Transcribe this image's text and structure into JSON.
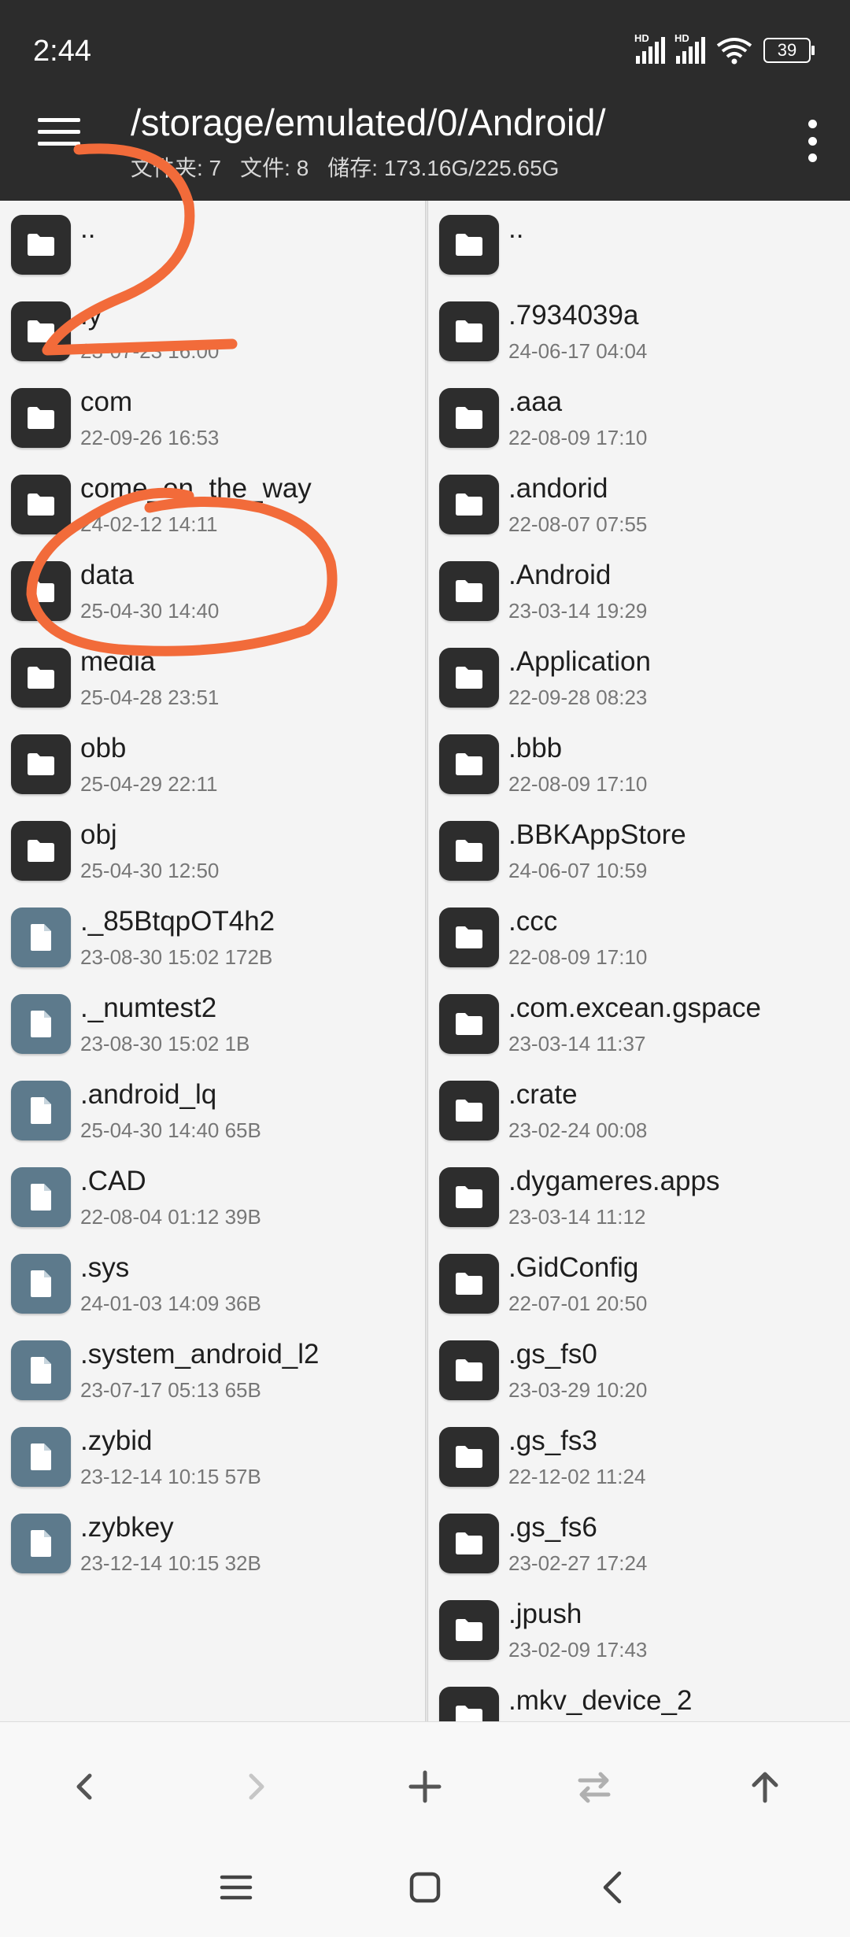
{
  "status": {
    "time": "2:44",
    "hd1": "HD",
    "hd2": "HD",
    "battery": "39"
  },
  "header": {
    "path": "/storage/emulated/0/Android/",
    "folders_label": "文件夹: 7",
    "files_label": "文件: 8",
    "storage_label": "储存: 173.16G/225.65G"
  },
  "left_pane": [
    {
      "name": "..",
      "meta": "",
      "type": "folder"
    },
    {
      "name": ".y",
      "meta": "23-07-23 16:00",
      "type": "folder"
    },
    {
      "name": "com",
      "meta": "22-09-26 16:53",
      "type": "folder"
    },
    {
      "name": "come_on_the_way",
      "meta": "24-02-12 14:11",
      "type": "folder"
    },
    {
      "name": "data",
      "meta": "25-04-30 14:40",
      "type": "folder"
    },
    {
      "name": "media",
      "meta": "25-04-28 23:51",
      "type": "folder"
    },
    {
      "name": "obb",
      "meta": "25-04-29 22:11",
      "type": "folder"
    },
    {
      "name": "obj",
      "meta": "25-04-30 12:50",
      "type": "folder"
    },
    {
      "name": "._85BtqpOT4h2",
      "meta": "23-08-30 15:02  172B",
      "type": "file"
    },
    {
      "name": "._numtest2",
      "meta": "23-08-30 15:02  1B",
      "type": "file"
    },
    {
      "name": ".android_lq",
      "meta": "25-04-30 14:40  65B",
      "type": "file"
    },
    {
      "name": ".CAD",
      "meta": "22-08-04 01:12  39B",
      "type": "file"
    },
    {
      "name": ".sys",
      "meta": "24-01-03 14:09  36B",
      "type": "file"
    },
    {
      "name": ".system_android_l2",
      "meta": "23-07-17 05:13  65B",
      "type": "file"
    },
    {
      "name": ".zybid",
      "meta": "23-12-14 10:15  57B",
      "type": "file"
    },
    {
      "name": ".zybkey",
      "meta": "23-12-14 10:15  32B",
      "type": "file"
    }
  ],
  "right_pane": [
    {
      "name": "..",
      "meta": "",
      "type": "folder"
    },
    {
      "name": ".7934039a",
      "meta": "24-06-17 04:04",
      "type": "folder"
    },
    {
      "name": ".aaa",
      "meta": "22-08-09 17:10",
      "type": "folder"
    },
    {
      "name": ".andorid",
      "meta": "22-08-07 07:55",
      "type": "folder"
    },
    {
      "name": ".Android",
      "meta": "23-03-14 19:29",
      "type": "folder"
    },
    {
      "name": ".Application",
      "meta": "22-09-28 08:23",
      "type": "folder"
    },
    {
      "name": ".bbb",
      "meta": "22-08-09 17:10",
      "type": "folder"
    },
    {
      "name": ".BBKAppStore",
      "meta": "24-06-07 10:59",
      "type": "folder"
    },
    {
      "name": ".ccc",
      "meta": "22-08-09 17:10",
      "type": "folder"
    },
    {
      "name": ".com.excean.gspace",
      "meta": "23-03-14 11:37",
      "type": "folder"
    },
    {
      "name": ".crate",
      "meta": "23-02-24 00:08",
      "type": "folder"
    },
    {
      "name": ".dygameres.apps",
      "meta": "23-03-14 11:12",
      "type": "folder"
    },
    {
      "name": ".GidConfig",
      "meta": "22-07-01 20:50",
      "type": "folder"
    },
    {
      "name": ".gs_fs0",
      "meta": "23-03-29 10:20",
      "type": "folder"
    },
    {
      "name": ".gs_fs3",
      "meta": "22-12-02 11:24",
      "type": "folder"
    },
    {
      "name": ".gs_fs6",
      "meta": "23-02-27 17:24",
      "type": "folder"
    },
    {
      "name": ".jpush",
      "meta": "23-02-09 17:43",
      "type": "folder"
    },
    {
      "name": ".mkv_device_2",
      "meta": "",
      "type": "folder"
    }
  ],
  "colors": {
    "header_bg": "#2c2c2c",
    "folder_icon": "#2d2d2d",
    "file_icon": "#5d7a8c",
    "annotation": "#f26b3a"
  }
}
